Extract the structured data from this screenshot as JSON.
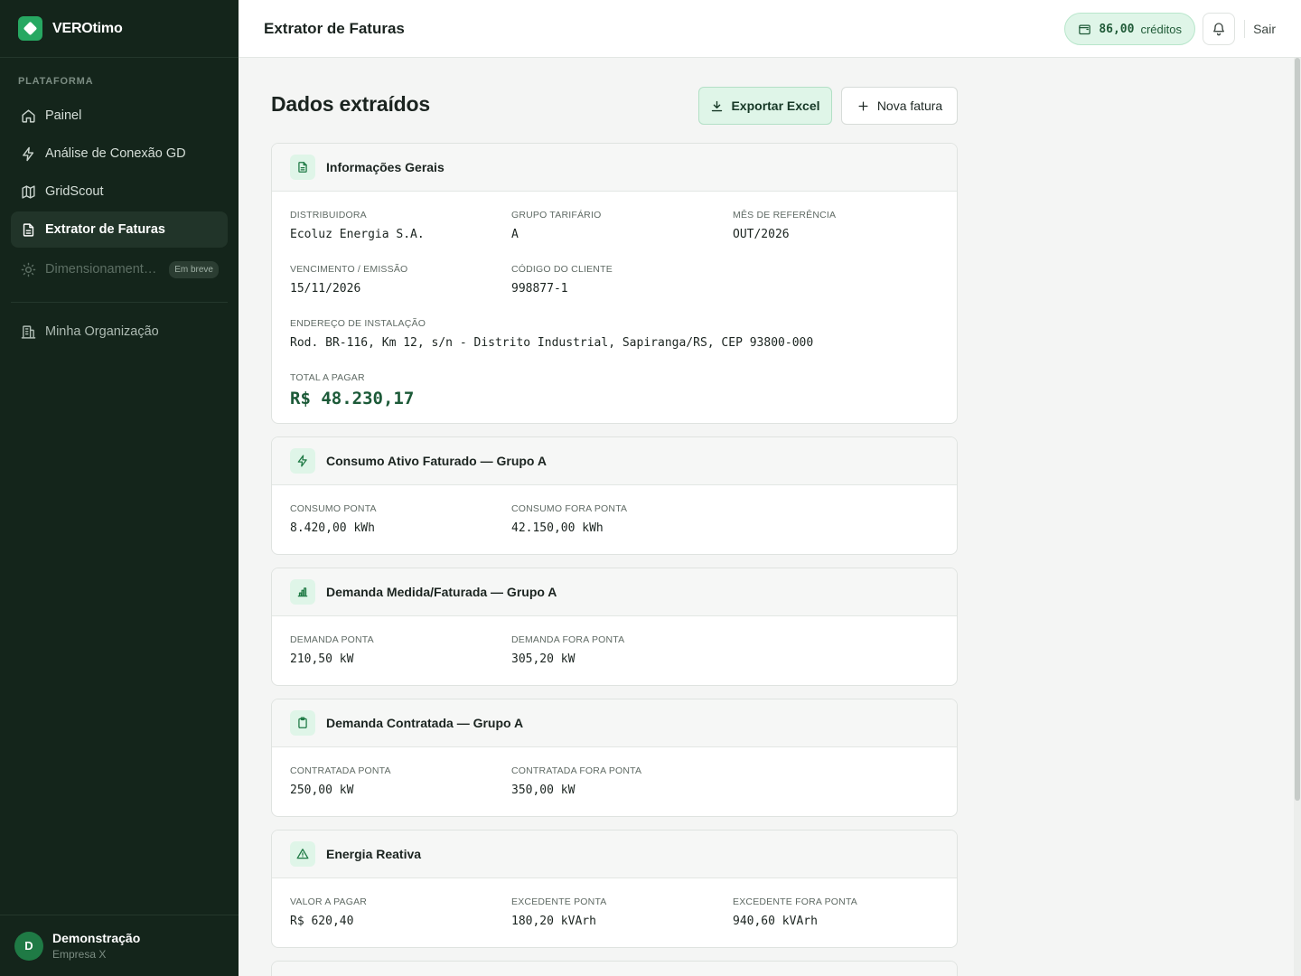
{
  "sidebar": {
    "brand": "VEROtimo",
    "section_label": "PLATAFORMA",
    "items": [
      {
        "label": "Painel"
      },
      {
        "label": "Análise de Conexão GD"
      },
      {
        "label": "GridScout"
      },
      {
        "label": "Extrator de Faturas"
      },
      {
        "label": "Dimensionamento...",
        "badge": "Em breve"
      },
      {
        "label": "Minha Organização"
      }
    ],
    "user": {
      "initial": "D",
      "name": "Demonstração",
      "org": "Empresa X"
    }
  },
  "header": {
    "title": "Extrator de Faturas",
    "credits_value": "86,00",
    "credits_label": "créditos",
    "logout": "Sair"
  },
  "main": {
    "title": "Dados extraídos",
    "export_label": "Exportar Excel",
    "new_label": "Nova fatura",
    "cards": [
      {
        "title": "Informações Gerais",
        "fields": [
          {
            "label": "DISTRIBUIDORA",
            "value": "Ecoluz Energia S.A."
          },
          {
            "label": "GRUPO TARIFÁRIO",
            "value": "A"
          },
          {
            "label": "MÊS DE REFERÊNCIA",
            "value": "OUT/2026"
          },
          {
            "label": "VENCIMENTO / EMISSÃO",
            "value": "15/11/2026"
          },
          {
            "label": "CÓDIGO DO CLIENTE",
            "value": "998877-1"
          },
          {
            "label": "ENDEREÇO DE INSTALAÇÃO",
            "value": "Rod. BR-116, Km 12, s/n - Distrito Industrial, Sapiranga/RS, CEP 93800-000"
          },
          {
            "label": "TOTAL A PAGAR",
            "value": "R$ 48.230,17"
          }
        ]
      },
      {
        "title": "Consumo Ativo Faturado — Grupo A",
        "fields": [
          {
            "label": "CONSUMO PONTA",
            "value": "8.420,00 kWh"
          },
          {
            "label": "CONSUMO FORA PONTA",
            "value": "42.150,00 kWh"
          }
        ]
      },
      {
        "title": "Demanda Medida/Faturada — Grupo A",
        "fields": [
          {
            "label": "DEMANDA PONTA",
            "value": "210,50 kW"
          },
          {
            "label": "DEMANDA FORA PONTA",
            "value": "305,20 kW"
          }
        ]
      },
      {
        "title": "Demanda Contratada — Grupo A",
        "fields": [
          {
            "label": "CONTRATADA PONTA",
            "value": "250,00 kW"
          },
          {
            "label": "CONTRATADA FORA PONTA",
            "value": "350,00 kW"
          }
        ]
      },
      {
        "title": "Energia Reativa",
        "fields": [
          {
            "label": "VALOR A PAGAR",
            "value": "R$ 620,40"
          },
          {
            "label": "EXCEDENTE PONTA",
            "value": "180,20 kVArh"
          },
          {
            "label": "EXCEDENTE FORA PONTA",
            "value": "940,60 kVArh"
          }
        ]
      }
    ]
  },
  "colors": {
    "sidebar_bg": "#14251b",
    "accent": "#27a862",
    "accent_light": "#dff5e8",
    "total_text": "#1c5a38"
  },
  "icons": [
    "home-icon",
    "bolt-icon",
    "map-icon",
    "document-icon",
    "sun-icon",
    "building-icon",
    "wallet-icon",
    "bell-icon",
    "download-icon",
    "plus-icon",
    "bar-chart-icon",
    "clipboard-icon",
    "warning-icon"
  ]
}
